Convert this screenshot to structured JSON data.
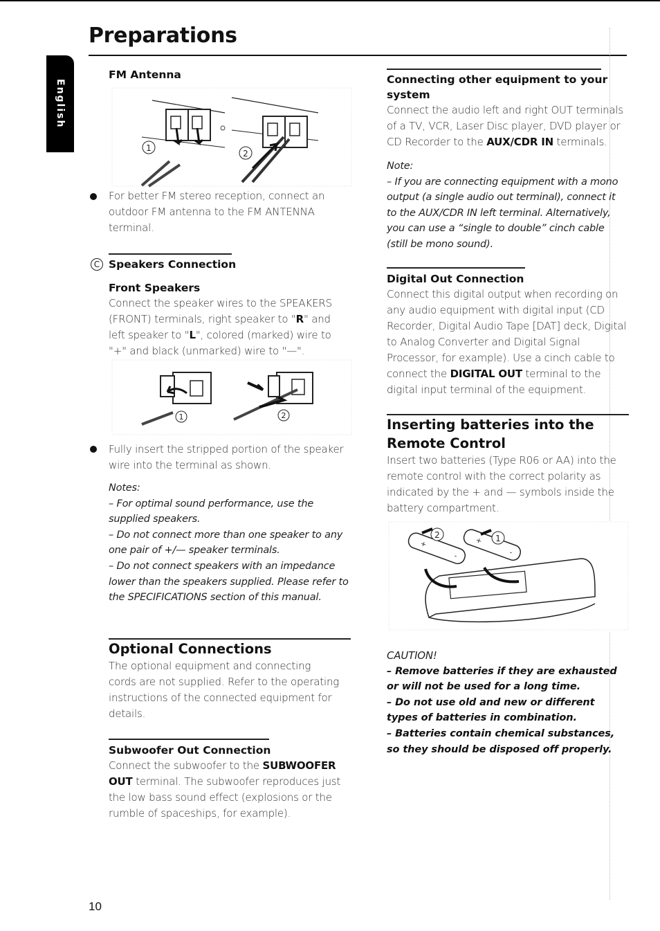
{
  "page": {
    "title": "Preparations",
    "language_tab": "English",
    "page_number": "10"
  },
  "left": {
    "fm_antenna": {
      "heading": "FM Antenna",
      "figure_steps": [
        "1",
        "2"
      ],
      "bullet": "For better FM stereo reception, connect an outdoor FM antenna to the FM ANTENNA terminal."
    },
    "speakers": {
      "marker": "C",
      "heading": "Speakers Connection",
      "subheading": "Front Speakers",
      "body_parts": [
        "Connect the speaker wires to the SPEAKERS (FRONT) terminals, right speaker to \"",
        "R",
        "\" and left speaker to \"",
        "L",
        "\", colored (marked) wire to \"+\" and black (unmarked) wire to \"—\"."
      ],
      "figure_steps": [
        "1",
        "2"
      ],
      "bullet": "Fully insert the stripped portion of the speaker wire into the terminal as shown.",
      "notes_label": "Notes:",
      "notes": [
        "–  For optimal sound performance, use the supplied speakers.",
        "–  Do not connect more than one speaker to any one pair of +/— speaker terminals.",
        "–  Do not connect speakers with an impedance lower than the speakers supplied.  Please refer to the SPECIFICATIONS section of this manual."
      ]
    },
    "optional": {
      "heading": "Optional Connections",
      "body": "The optional equipment and connecting cords are not supplied.  Refer to the operating instructions of the connected equipment for details."
    },
    "subwoofer": {
      "heading": "Subwoofer Out Connection",
      "body_pre": "Connect the subwoofer to the ",
      "body_bold": "SUBWOOFER OUT",
      "body_post": " terminal. The subwoofer reproduces just the low bass sound effect (explosions or the rumble of spaceships, for example)."
    }
  },
  "right": {
    "other_equipment": {
      "heading": "Connecting other equipment to your system",
      "body_pre": "Connect the audio left and right OUT terminals of a  TV, VCR, Laser Disc player, DVD player or CD Recorder to the ",
      "body_bold": "AUX/CDR IN",
      "body_post": " terminals.",
      "note_label": "Note:",
      "note": "–  If you are connecting equipment with a mono output (a single audio out terminal), connect it to the AUX/CDR IN left terminal.  Alternatively, you can use a “single to double” cinch cable (still be mono sound)."
    },
    "digital_out": {
      "heading": "Digital Out Connection",
      "body_pre": "Connect this digital output when recording on any audio equipment with digital input (CD Recorder, Digital Audio Tape [DAT] deck, Digital to Analog Converter and Digital Signal Processor, for example).  Use a cinch cable to connect the ",
      "body_bold": "DIGITAL OUT",
      "body_post": " terminal to the digital input terminal of the equipment."
    },
    "batteries": {
      "heading": "Inserting batteries into the Remote Control",
      "body": "Insert two batteries (Type R06 or AA) into the remote control with the correct polarity as indicated by the  +  and  —  symbols inside the battery compartment.",
      "figure_steps": [
        "2",
        "1"
      ],
      "caution_label": "CAUTION!",
      "cautions": [
        "–  Remove batteries if they are exhausted or will not be used for a long time.",
        "–  Do not use old and new or different types of batteries in combination.",
        "–  Batteries contain chemical substances, so they should be disposed off properly."
      ]
    }
  }
}
